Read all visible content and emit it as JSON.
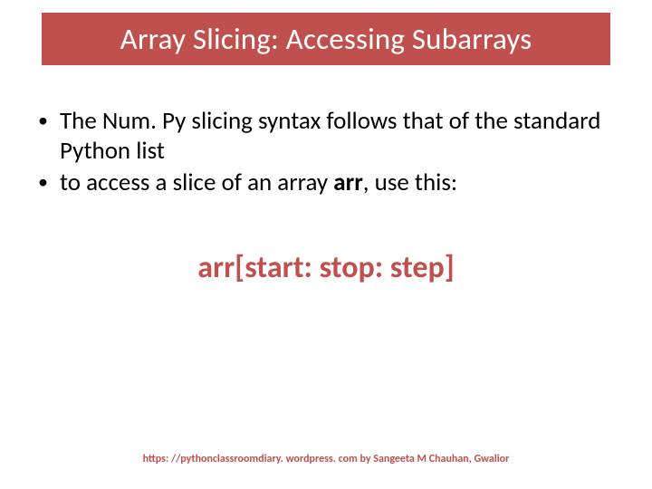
{
  "title": "Array Slicing: Accessing Subarrays",
  "bullets": [
    {
      "pre": "The Num. Py slicing syntax follows that of the standard Python list",
      "bold": "",
      "post": ""
    },
    {
      "pre": "to access a slice of an array ",
      "bold": "arr",
      "post": ", use this:"
    }
  ],
  "syntax": "arr[start: stop: step]",
  "footer": {
    "url": "https: //pythonclassroomdiary. wordpress. com",
    "by": " by  Sangeeta M Chauhan, Gwalior"
  }
}
